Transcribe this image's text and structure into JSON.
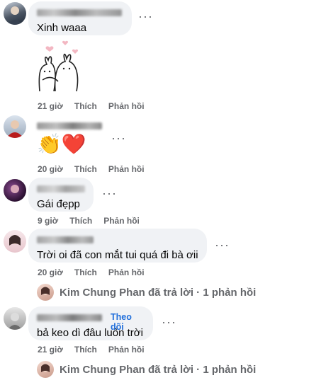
{
  "comments": [
    {
      "author_name": "",
      "text": "Xinh waaa",
      "time": "21 giờ",
      "like_label": "Thích",
      "reply_label": "Phản hồi",
      "sticker": "bunny-hug-sticker"
    },
    {
      "author_name": "",
      "text": "",
      "emojis": "👏❤️",
      "time": "20 giờ",
      "like_label": "Thích",
      "reply_label": "Phản hồi"
    },
    {
      "author_name": "",
      "text": "Gái đẹpp",
      "time": "9 giờ",
      "like_label": "Thích",
      "reply_label": "Phản hồi"
    },
    {
      "author_name": "",
      "text": "Trời oi đã con mắt tui quá đi bà ơii",
      "time": "20 giờ",
      "like_label": "Thích",
      "reply_label": "Phản hồi",
      "replies_summary": "Kim Chung Phan đã trả lời · 1 phản hồi"
    },
    {
      "author_name": "",
      "follow_label": "Theo dõi",
      "text": "bả keo dì đâu luôn trời",
      "time": "21 giờ",
      "like_label": "Thích",
      "reply_label": "Phản hồi",
      "replies_summary": "Kim Chung Phan đã trả lời · 1 phản hồi"
    }
  ],
  "more_icon": "more-dots-icon",
  "colors": {
    "bubble": "#f0f2f5",
    "meta": "#65676b",
    "link": "#216fdb"
  }
}
